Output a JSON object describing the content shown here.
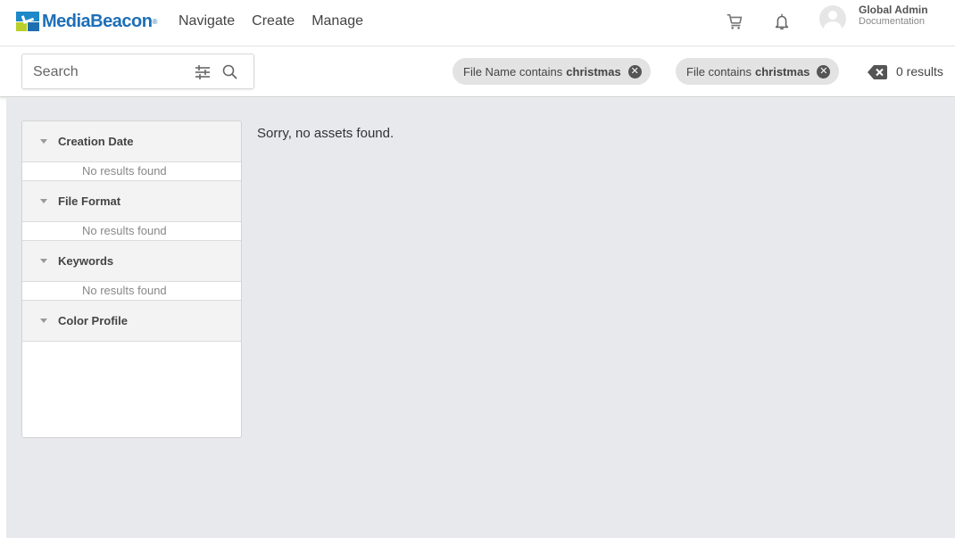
{
  "brand": {
    "name": "MediaBeacon",
    "reg": "®"
  },
  "nav": [
    {
      "label": "Navigate"
    },
    {
      "label": "Create"
    },
    {
      "label": "Manage"
    }
  ],
  "header_icons": {
    "cart": "cart-icon",
    "bell": "bell-icon"
  },
  "user": {
    "name": "Global Admin",
    "org": "Documentation"
  },
  "search": {
    "placeholder": "Search",
    "value": ""
  },
  "filters": [
    {
      "prefix": "File Name contains",
      "term": "christmas"
    },
    {
      "prefix": "File contains",
      "term": "christmas"
    }
  ],
  "results": {
    "label": "0 results"
  },
  "facets": [
    {
      "title": "Creation Date",
      "empty": "No results found"
    },
    {
      "title": "File Format",
      "empty": "No results found"
    },
    {
      "title": "Keywords",
      "empty": "No results found"
    },
    {
      "title": "Color Profile",
      "empty": ""
    }
  ],
  "main": {
    "empty_message": "Sorry, no assets found."
  },
  "colors": {
    "brand_blue": "#1d6fb8",
    "brand_lime": "#b9cf2b",
    "content_bg": "#e8e9ed"
  }
}
